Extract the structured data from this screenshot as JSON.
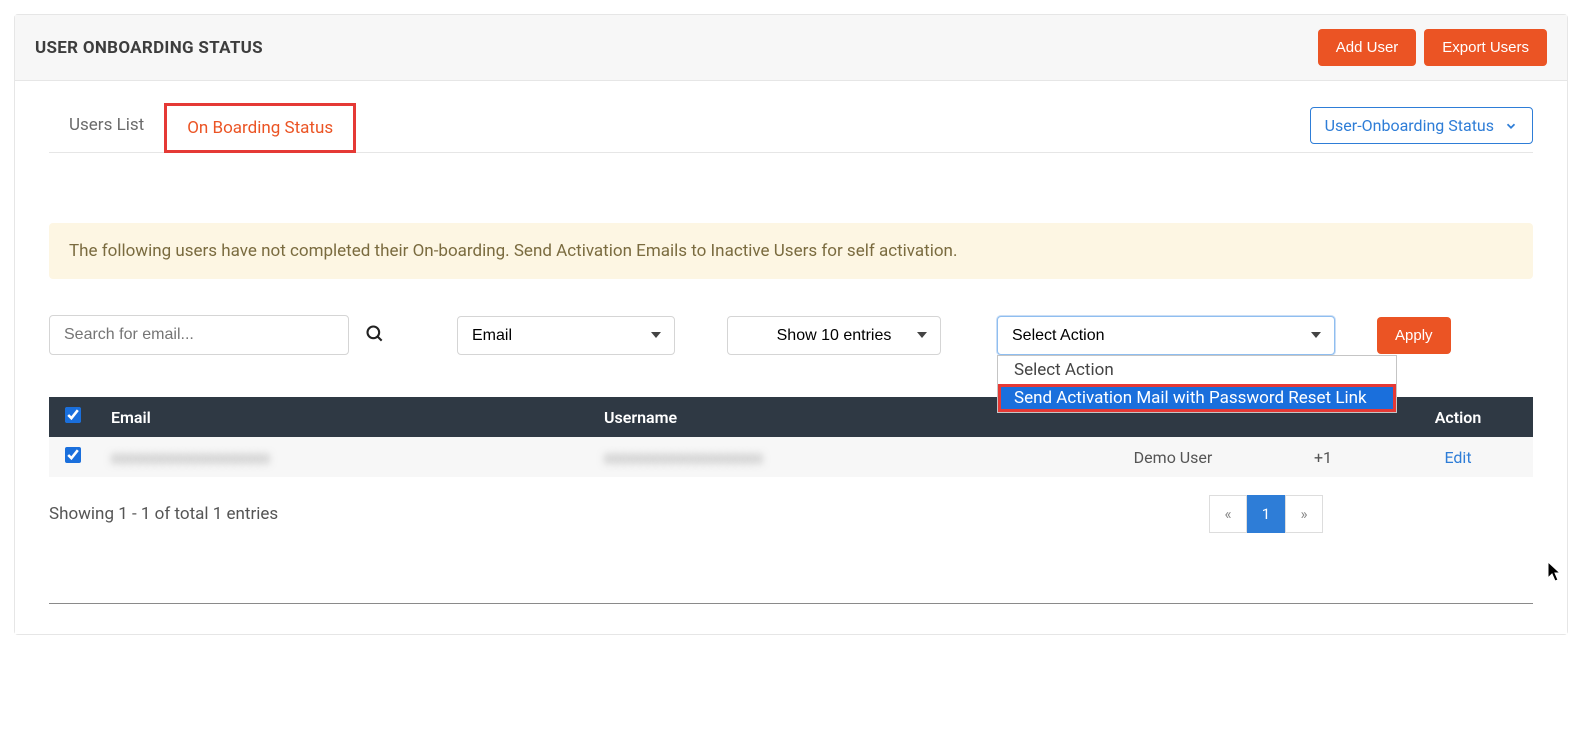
{
  "header": {
    "title": "USER ONBOARDING STATUS",
    "add_user": "Add User",
    "export_users": "Export Users"
  },
  "tabs": {
    "users_list": "Users List",
    "onboarding_status": "On Boarding Status"
  },
  "status_filter": {
    "label": "User-Onboarding Status"
  },
  "alert": {
    "text": "The following users have not completed their On-boarding. Send Activation Emails to Inactive Users for self activation."
  },
  "search": {
    "placeholder": "Search for email..."
  },
  "filter_select": {
    "value": "Email"
  },
  "entries_select": {
    "value": "Show 10 entries"
  },
  "action_select": {
    "value": "Select Action",
    "options": {
      "opt0": "Select Action",
      "opt1": "Send Activation Mail with Password Reset Link"
    }
  },
  "apply": "Apply",
  "table": {
    "headers": {
      "email": "Email",
      "username": "Username",
      "role": "",
      "groups": "",
      "action": "Action"
    },
    "rows": [
      {
        "email": "xxxxxxxxxxxxxxxxxxxx",
        "username": "xxxxxxxxxxxxxxxxxxxx",
        "role": "Demo User",
        "groups": "+1",
        "action": "Edit"
      }
    ]
  },
  "footer": {
    "showing": "Showing 1 - 1 of total 1 entries",
    "page": "1",
    "prev": "«",
    "next": "»"
  }
}
